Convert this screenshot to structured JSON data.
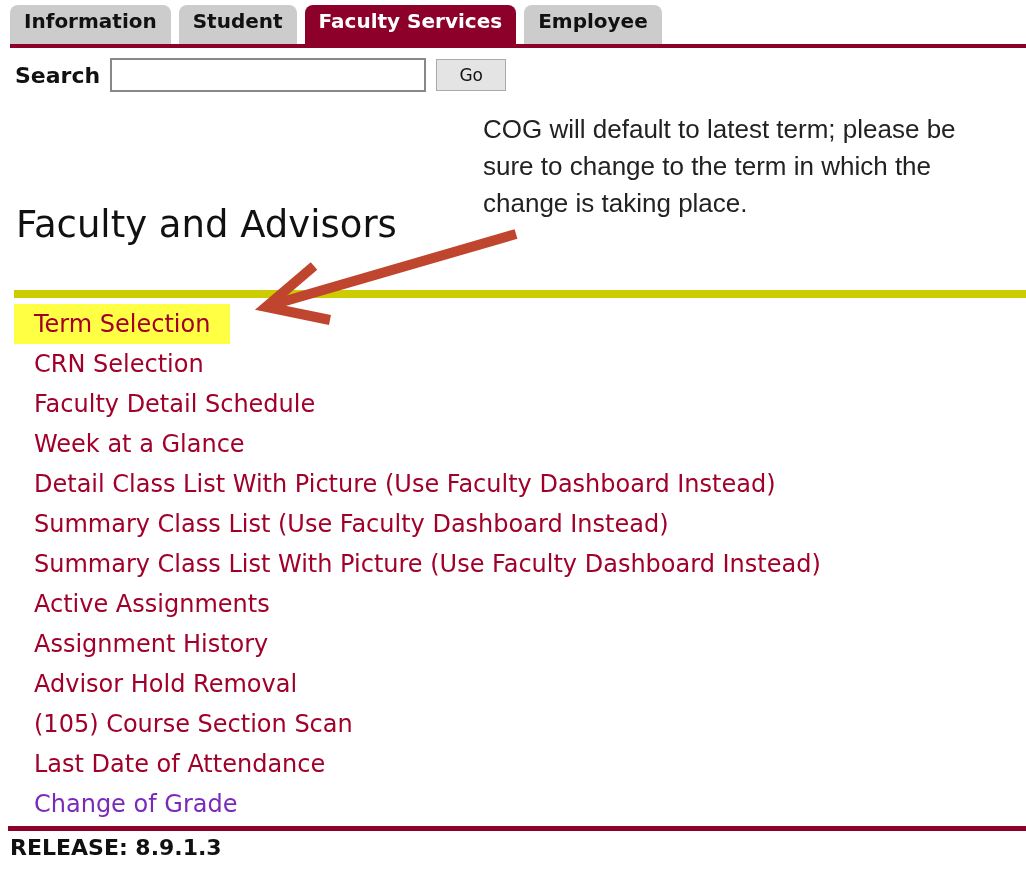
{
  "tabs": [
    {
      "label": "Information",
      "selected": false
    },
    {
      "label": "Student",
      "selected": false
    },
    {
      "label": "Faculty Services",
      "selected": true
    },
    {
      "label": "Employee",
      "selected": false
    }
  ],
  "search": {
    "label": "Search",
    "button": "Go"
  },
  "heading": "Faculty and Advisors",
  "callout": "COG will default to latest term; please be sure to change to the term in which the change is taking place.",
  "links": [
    {
      "label": "Term Selection",
      "highlighted": true,
      "visited": false
    },
    {
      "label": "CRN Selection",
      "highlighted": false,
      "visited": false
    },
    {
      "label": "Faculty Detail Schedule",
      "highlighted": false,
      "visited": false
    },
    {
      "label": "Week at a Glance",
      "highlighted": false,
      "visited": false
    },
    {
      "label": "Detail Class List With Picture (Use Faculty Dashboard Instead)",
      "highlighted": false,
      "visited": false
    },
    {
      "label": "Summary Class List (Use Faculty Dashboard Instead)",
      "highlighted": false,
      "visited": false
    },
    {
      "label": "Summary Class List With Picture (Use Faculty Dashboard Instead)",
      "highlighted": false,
      "visited": false
    },
    {
      "label": "Active Assignments",
      "highlighted": false,
      "visited": false
    },
    {
      "label": "Assignment History",
      "highlighted": false,
      "visited": false
    },
    {
      "label": "Advisor Hold Removal",
      "highlighted": false,
      "visited": false
    },
    {
      "label": "(105) Course Section Scan",
      "highlighted": false,
      "visited": false
    },
    {
      "label": "Last Date of Attendance",
      "highlighted": false,
      "visited": false
    },
    {
      "label": "Change of Grade",
      "highlighted": false,
      "visited": true
    }
  ],
  "release": "RELEASE: 8.9.1.3"
}
